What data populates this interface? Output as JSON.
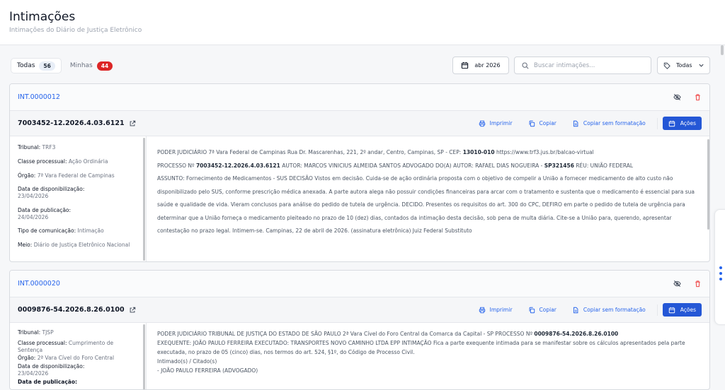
{
  "page": {
    "title": "Intimações",
    "subtitle": "Intimações do Diário de Justiça Eletrônico"
  },
  "tabs": [
    {
      "label": "Todas",
      "count": "56"
    },
    {
      "label": "Minhas",
      "count": "44"
    }
  ],
  "date_filter": {
    "label": "abr 2026",
    "icon": "calendar-icon"
  },
  "search": {
    "placeholder": "Buscar intimações...",
    "icon": "search-icon"
  },
  "filter": {
    "label": "Todas",
    "icon": "tag-icon"
  },
  "colors": {
    "accent": "#2563eb",
    "danger": "#dc2626",
    "button": "#2457d6"
  },
  "actions": {
    "print": "Imprimir",
    "copy": "Copiar",
    "copy_plain": "Copiar sem formatação",
    "acoes": "Ações"
  },
  "cards": [
    {
      "int_prefix": "INT.",
      "int_number": "0000012",
      "process": "7003452-12.2026.4.03.6121",
      "meta": [
        {
          "label": "Tribunal:",
          "value": "TRF3"
        },
        {
          "label": "Classe processual:",
          "value": "Ação Ordinária"
        },
        {
          "label": "Órgão:",
          "value": "7ª Vara Federal de Campinas"
        },
        {
          "label": "Data de disponibilização:",
          "value": "23/04/2026"
        },
        {
          "label": "Data de publicação:",
          "value": "24/04/2026"
        },
        {
          "label": "Tipo de comunicação:",
          "value": "Intimação"
        },
        {
          "label": "Meio:",
          "value": "Diário de Justiça Eletrônico Nacional"
        }
      ],
      "text": {
        "p1": "PODER JUDICIÁRIO 7ª Vara Federal de Campinas Rua Dr. Mascarenhas, 221, 2º andar, Centro, Campinas, SP - CEP: ",
        "p1b": "13010-010",
        "p1c": " https://www.trf3.jus.br/balcao-virtual",
        "p2": "PROCESSO Nº ",
        "p2b": "7003452-12.2026.4.03.6121",
        "p2c": " AUTOR: MARCOS VINICIUS ALMEIDA SANTOS ADVOGADO DO(A) AUTOR: RAFAEL DIAS NOGUEIRA - ",
        "p2d": "SP321456",
        "p2e": " RÉU: UNIÃO FEDERAL",
        "p3": "ASSUNTO: Fornecimento de Medicamentos - SUS DECISÃO Vistos em decisão. Cuida-se de ação ordinária proposta com o objetivo de compelir a União a fornecer medicamento de alto custo não disponibilizado pelo SUS, conforme prescrição médica anexada. A parte autora alega não possuir condições financeiras para arcar com o tratamento e sustenta que o medicamento é essencial para sua saúde e qualidade de vida. Vieram conclusos para análise do pedido de tutela de urgência. DECIDO. Presentes os requisitos do art. 300 do CPC, DEFIRO em parte o pedido de tutela de urgência para determinar que a União forneça o medicamento pleiteado no prazo de 10 (dez) dias, contados da intimação desta decisão, sob pena de multa diária. Cite-se a União para, querendo, apresentar contestação no prazo legal. Intimem-se. Campinas, 22 de abril de 2026. (assinatura eletrônica) Juiz Federal Substituto"
      }
    },
    {
      "int_prefix": "INT.",
      "int_number": "0000020",
      "process": "0009876-54.2026.8.26.0100",
      "meta": [
        {
          "label": "Tribunal:",
          "value": "TJSP"
        },
        {
          "label": "Classe processual:",
          "value": "Cumprimento de Sentença"
        },
        {
          "label": "Órgão:",
          "value": "2ª Vara Cível do Foro Central"
        },
        {
          "label": "Data de disponibilização:",
          "value": "23/04/2026"
        },
        {
          "label": "Data de publicação:",
          "value": ""
        }
      ],
      "text": {
        "p1": "PODER JUDICIÁRIO TRIBUNAL DE JUSTIÇA DO ESTADO DE SÃO PAULO 2ª Vara Cível do Foro Central da Comarca da Capital - SP PROCESSO Nº ",
        "p1b": "0009876-54.2026.8.26.0100",
        "p2": "EXEQUENTE: JOÃO PAULO FERREIRA EXECUTADO: TRANSPORTES NOVO CAMINHO LTDA EPP INTIMAÇÃO Fica a parte exequente intimada para se manifestar sobre os cálculos apresentados pela parte executada, no prazo de 05 (cinco) dias, nos termos do art. 524, §1º, do Código de Processo Civil.",
        "p3": "Intimado(s) / Citado(s)",
        "p4": "- JOÃO PAULO FERREIRA (ADVOGADO)"
      }
    }
  ]
}
